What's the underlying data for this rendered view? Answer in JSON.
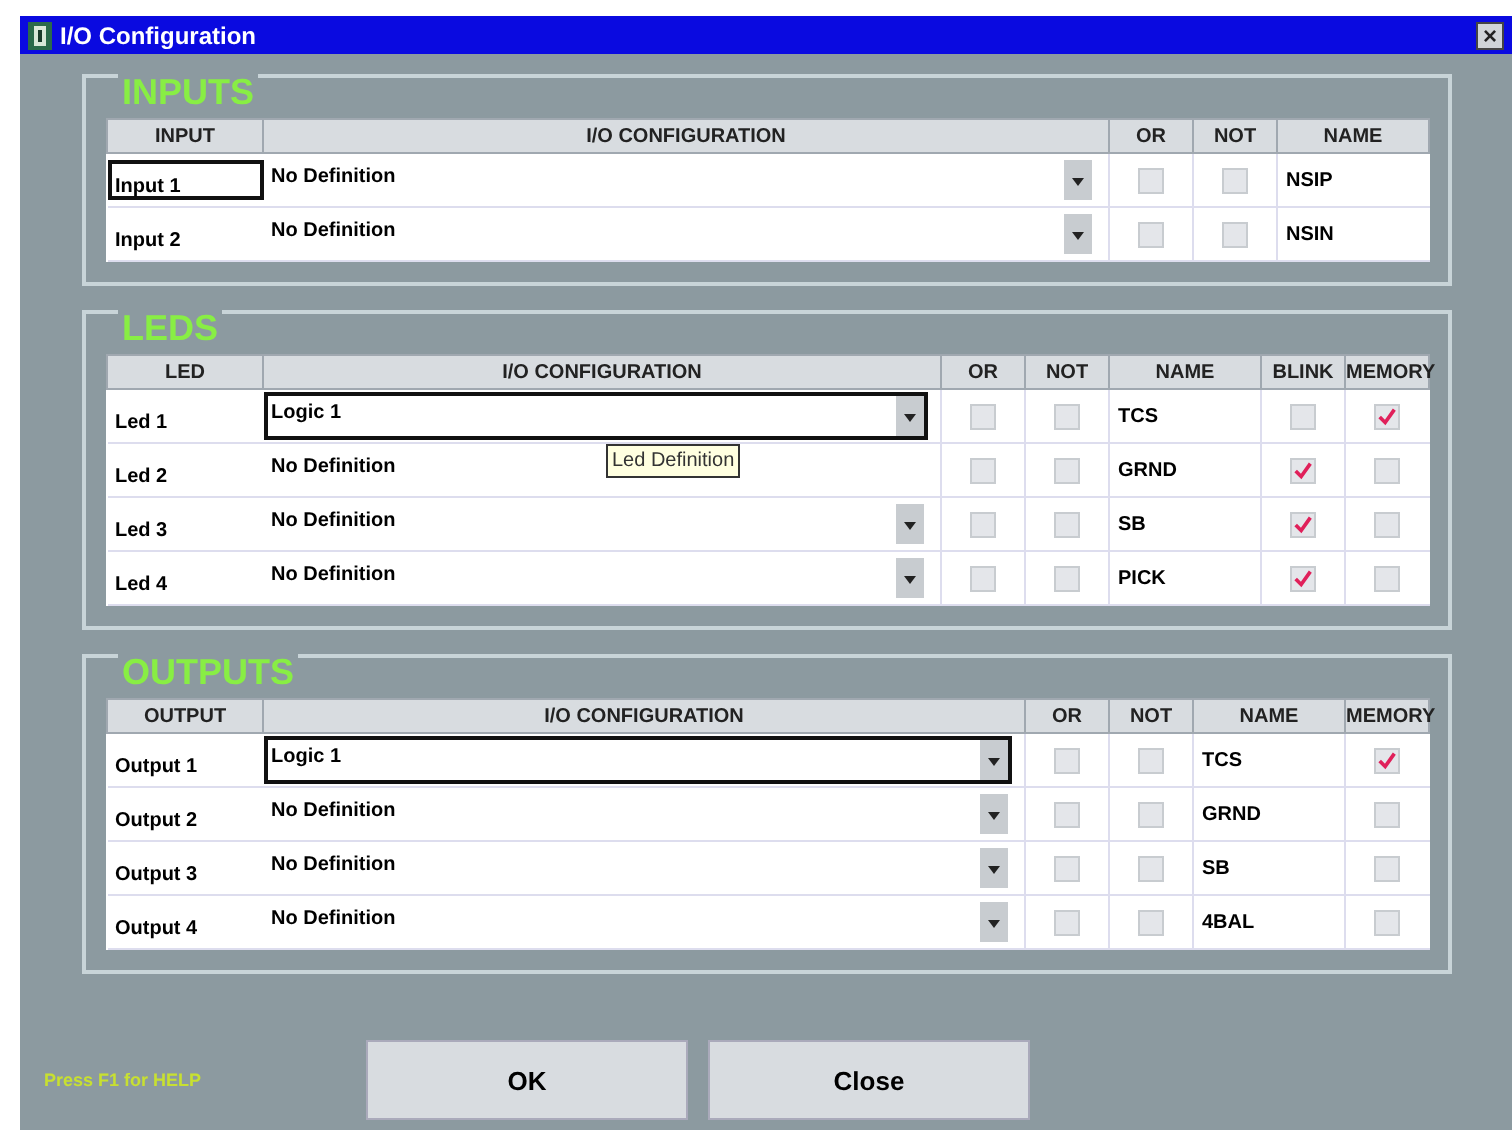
{
  "window": {
    "title": "I/O Configuration",
    "close": "×"
  },
  "sections": [
    {
      "legend": "INPUTS",
      "columns": [
        {
          "label": "INPUT",
          "kind": "label"
        },
        {
          "label": "I/O CONFIGURATION",
          "kind": "config"
        },
        {
          "label": "OR",
          "kind": "check"
        },
        {
          "label": "NOT",
          "kind": "check"
        },
        {
          "label": "NAME",
          "kind": "name"
        }
      ],
      "rows": [
        {
          "cells": [
            {
              "text": "Input 1",
              "focused": true
            },
            {
              "text": "No Definition",
              "focused": false,
              "dropdown": true
            },
            {
              "checked": false
            },
            {
              "checked": false
            },
            {
              "text": "NSIP"
            }
          ]
        },
        {
          "cells": [
            {
              "text": "Input 2",
              "focused": false
            },
            {
              "text": "No Definition",
              "focused": false,
              "dropdown": true
            },
            {
              "checked": false
            },
            {
              "checked": false
            },
            {
              "text": "NSIN"
            }
          ]
        }
      ]
    },
    {
      "legend": "LEDS",
      "tooltip": "Led Definition",
      "columns": [
        {
          "label": "LED",
          "kind": "label"
        },
        {
          "label": "I/O CONFIGURATION",
          "kind": "config"
        },
        {
          "label": "OR",
          "kind": "check"
        },
        {
          "label": "NOT",
          "kind": "check"
        },
        {
          "label": "NAME",
          "kind": "name"
        },
        {
          "label": "BLINK",
          "kind": "check"
        },
        {
          "label": "MEMORY",
          "kind": "check"
        }
      ],
      "rows": [
        {
          "cells": [
            {
              "text": "Led 1",
              "focused": false
            },
            {
              "text": "Logic 1",
              "focused": true,
              "dropdown": true
            },
            {
              "checked": false
            },
            {
              "checked": false
            },
            {
              "text": "TCS"
            },
            {
              "checked": false
            },
            {
              "checked": true
            }
          ]
        },
        {
          "cells": [
            {
              "text": "Led 2",
              "focused": false
            },
            {
              "text": "No Definition",
              "focused": false,
              "dropdown": false
            },
            {
              "checked": false
            },
            {
              "checked": false
            },
            {
              "text": "GRND"
            },
            {
              "checked": true
            },
            {
              "checked": false
            }
          ]
        },
        {
          "cells": [
            {
              "text": "Led 3",
              "focused": false
            },
            {
              "text": "No Definition",
              "focused": false,
              "dropdown": true
            },
            {
              "checked": false
            },
            {
              "checked": false
            },
            {
              "text": "SB"
            },
            {
              "checked": true
            },
            {
              "checked": false
            }
          ]
        },
        {
          "cells": [
            {
              "text": "Led 4",
              "focused": false
            },
            {
              "text": "No Definition",
              "focused": false,
              "dropdown": true
            },
            {
              "checked": false
            },
            {
              "checked": false
            },
            {
              "text": "PICK"
            },
            {
              "checked": true
            },
            {
              "checked": false
            }
          ]
        }
      ]
    },
    {
      "legend": "OUTPUTS",
      "columns": [
        {
          "label": "OUTPUT",
          "kind": "label"
        },
        {
          "label": "I/O CONFIGURATION",
          "kind": "config"
        },
        {
          "label": "OR",
          "kind": "check"
        },
        {
          "label": "NOT",
          "kind": "check"
        },
        {
          "label": "NAME",
          "kind": "name"
        },
        {
          "label": "MEMORY",
          "kind": "check"
        }
      ],
      "rows": [
        {
          "cells": [
            {
              "text": "Output 1",
              "focused": false
            },
            {
              "text": "Logic 1",
              "focused": true,
              "dropdown": true
            },
            {
              "checked": false
            },
            {
              "checked": false
            },
            {
              "text": "TCS"
            },
            {
              "checked": true
            }
          ]
        },
        {
          "cells": [
            {
              "text": "Output 2",
              "focused": false
            },
            {
              "text": "No Definition",
              "focused": false,
              "dropdown": true
            },
            {
              "checked": false
            },
            {
              "checked": false
            },
            {
              "text": "GRND"
            },
            {
              "checked": false
            }
          ]
        },
        {
          "cells": [
            {
              "text": "Output 3",
              "focused": false
            },
            {
              "text": "No Definition",
              "focused": false,
              "dropdown": true
            },
            {
              "checked": false
            },
            {
              "checked": false
            },
            {
              "text": "SB"
            },
            {
              "checked": false
            }
          ]
        },
        {
          "cells": [
            {
              "text": "Output 4",
              "focused": false
            },
            {
              "text": "No Definition",
              "focused": false,
              "dropdown": true
            },
            {
              "checked": false
            },
            {
              "checked": false
            },
            {
              "text": "4BAL"
            },
            {
              "checked": false
            }
          ]
        }
      ]
    }
  ],
  "help": "Press F1 for HELP",
  "buttons": [
    "OK",
    "Close"
  ]
}
